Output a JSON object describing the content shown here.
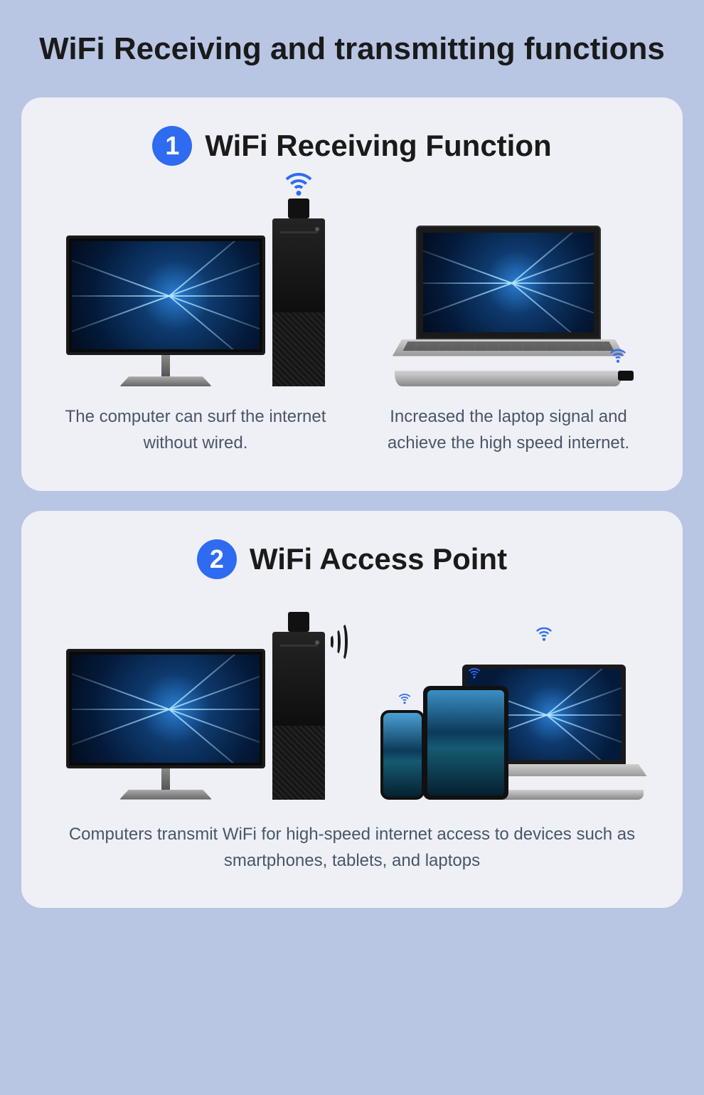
{
  "title": "WiFi Receiving and transmitting functions",
  "card1": {
    "badge": "1",
    "title": "WiFi Receiving Function",
    "left_caption": "The computer can surf the internet without wired.",
    "right_caption": "Increased the laptop signal and achieve the high speed internet."
  },
  "card2": {
    "badge": "2",
    "title": "WiFi Access Point",
    "caption": "Computers transmit WiFi for high-speed internet access to devices such as smartphones, tablets, and laptops"
  }
}
